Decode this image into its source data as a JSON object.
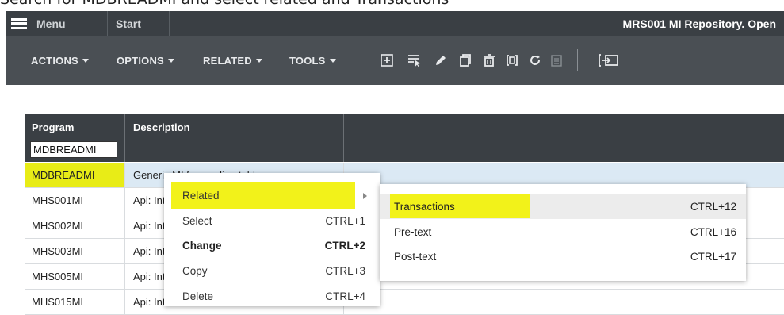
{
  "instruction": "Search for MDBREADMI and select related and Transactions",
  "topbar": {
    "menu_label": "Menu",
    "start_label": "Start",
    "title": "MRS001 MI Repository. Open"
  },
  "toolbar": {
    "menus": [
      "ACTIONS",
      "OPTIONS",
      "RELATED",
      "TOOLS"
    ],
    "icons": [
      "add-icon",
      "select-icon",
      "edit-icon",
      "copy-icon",
      "delete-icon",
      "duplicate-icon",
      "refresh-icon",
      "notes-icon",
      "export-icon"
    ]
  },
  "grid": {
    "columns": [
      "Program",
      "Description"
    ],
    "filter_value": "MDBREADMI",
    "rows": [
      {
        "program": "MDBREADMI",
        "description": "Generic MI for reading tables"
      },
      {
        "program": "MHS001MI",
        "description": "Api: Int"
      },
      {
        "program": "MHS002MI",
        "description": "Api: Int"
      },
      {
        "program": "MHS003MI",
        "description": "Api: Int"
      },
      {
        "program": "MHS005MI",
        "description": "Api: Int"
      },
      {
        "program": "MHS015MI",
        "description": "Api: Int"
      }
    ]
  },
  "context_menu": {
    "items": [
      {
        "label": "Related",
        "shortcut": ""
      },
      {
        "label": "Select",
        "shortcut": "CTRL+1"
      },
      {
        "label": "Change",
        "shortcut": "CTRL+2"
      },
      {
        "label": "Copy",
        "shortcut": "CTRL+3"
      },
      {
        "label": "Delete",
        "shortcut": "CTRL+4"
      }
    ]
  },
  "submenu": {
    "items": [
      {
        "label": "Transactions",
        "shortcut": "CTRL+12"
      },
      {
        "label": "Pre-text",
        "shortcut": "CTRL+16"
      },
      {
        "label": "Post-text",
        "shortcut": "CTRL+17"
      }
    ]
  },
  "colors": {
    "topbar": "#3a3f44",
    "toolbar": "#4a4f54",
    "highlight": "#f2f21a",
    "selected_row": "#dbe9f4"
  }
}
